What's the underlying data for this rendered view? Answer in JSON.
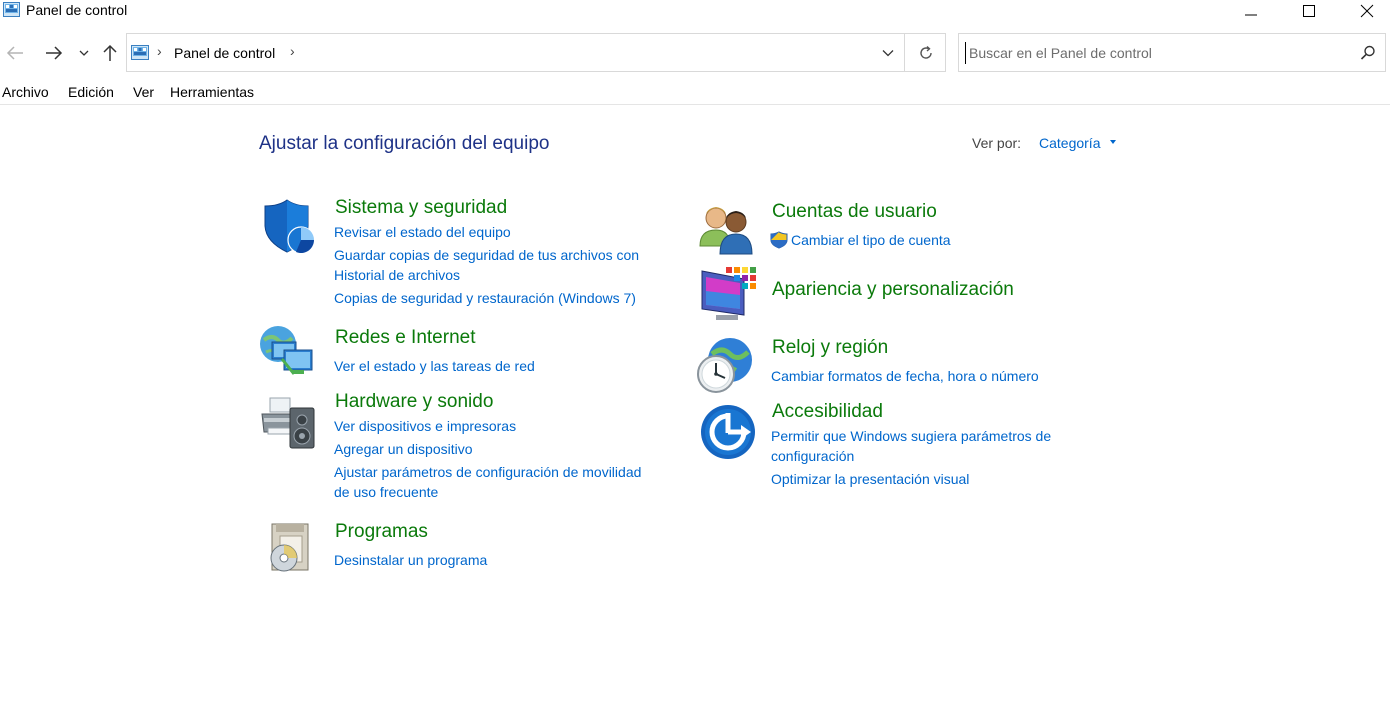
{
  "window": {
    "title": "Panel de control"
  },
  "address": {
    "path": "Panel de control"
  },
  "search": {
    "placeholder": "Buscar en el Panel de control"
  },
  "menu": [
    "Archivo",
    "Edición",
    "Ver",
    "Herramientas"
  ],
  "content": {
    "heading": "Ajustar la configuración del equipo",
    "view_by_label": "Ver por:",
    "view_by_value": "Categoría"
  },
  "categories": {
    "sistema": {
      "title": "Sistema y seguridad",
      "links": [
        "Revisar el estado del equipo",
        "Guardar copias de seguridad de tus archivos con",
        "Historial de archivos",
        "Copias de seguridad y restauración (Windows 7)"
      ]
    },
    "redes": {
      "title": "Redes e Internet",
      "links": [
        "Ver el estado y las tareas de red"
      ]
    },
    "hardware": {
      "title": "Hardware y sonido",
      "links": [
        "Ver dispositivos e impresoras",
        "Agregar un dispositivo",
        "Ajustar parámetros de configuración de movilidad",
        "de uso frecuente"
      ]
    },
    "programas": {
      "title": "Programas",
      "links": [
        "Desinstalar un programa"
      ]
    },
    "cuentas": {
      "title": "Cuentas de usuario",
      "links": [
        "Cambiar el tipo de cuenta"
      ]
    },
    "apariencia": {
      "title": "Apariencia y personalización",
      "links": []
    },
    "reloj": {
      "title": "Reloj y región",
      "links": [
        "Cambiar formatos de fecha, hora o número"
      ]
    },
    "accesibilidad": {
      "title": "Accesibilidad",
      "links": [
        "Permitir que Windows sugiera parámetros de",
        "configuración",
        "Optimizar la presentación visual"
      ]
    }
  },
  "colors": {
    "category_title": "#0b7a0b",
    "link": "#0066cc",
    "heading": "#1e3287"
  }
}
